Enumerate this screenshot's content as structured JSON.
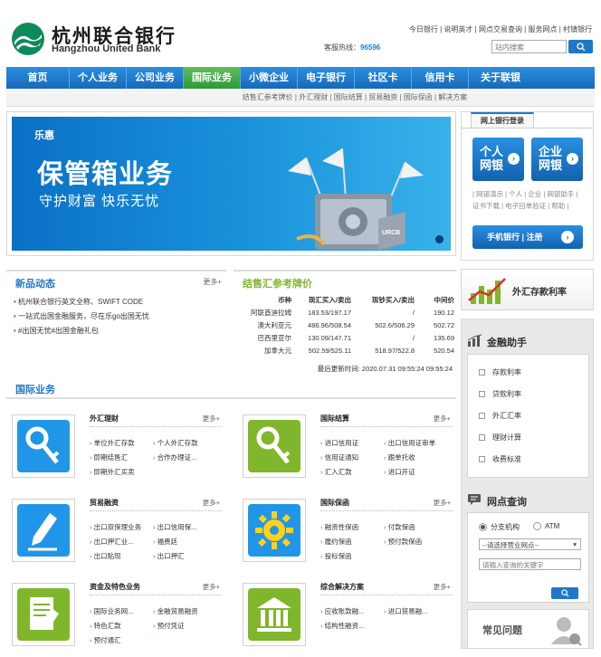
{
  "brand": {
    "name_cn": "杭州联合银行",
    "name_en": "Hangzhou United Bank"
  },
  "top_links": {
    "text": "今日银行 | 说明英才 | 网点交易查询 | 服务网点 | 村镇银行"
  },
  "hotline": {
    "label": "客服热线：",
    "number": "96596"
  },
  "search": {
    "placeholder": "站内搜索"
  },
  "nav": {
    "items": [
      "首页",
      "个人业务",
      "公司业务",
      "国际业务",
      "小微企业",
      "电子银行",
      "社区卡",
      "信用卡",
      "关于联银"
    ],
    "active": "国际业务"
  },
  "subnav": {
    "text": "结售汇参考牌价 | 外汇理财 | 国际结算 | 贸易融资 | 国际保函 | 解决方案"
  },
  "banner": {
    "brand": "乐惠",
    "title": "保管箱业务",
    "subtitle": "守护财富  快乐无忧",
    "badge": "URCB"
  },
  "login": {
    "tab": "网上银行登录",
    "personal": "个人网银",
    "corporate": "企业网银",
    "links": "| 网银演示 | 个人 | 企业 | 网银助手 | 证书下载 | 电子回单验证 | 帮助 |",
    "mobile": "手机银行 | 注册"
  },
  "news": {
    "title": "新品动态",
    "more": "更多+",
    "items": [
      "杭州联合银行英文全称、SWIFT CODE",
      "一站式出国金融服务，尽在乐go出国无忧",
      "#出国无忧#出国金融礼包"
    ]
  },
  "fx": {
    "title": "结售汇参考牌价",
    "headers": [
      "币种",
      "现汇买入/卖出",
      "现钞买入/卖出",
      "中间价"
    ],
    "rows": [
      [
        "阿联酋迪拉姆",
        "183.53/197.17",
        "/",
        "190.12"
      ],
      [
        "澳大利亚元",
        "486.96/508.54",
        "502.6/506.29",
        "502.72"
      ],
      [
        "巴西里亚尔",
        "130.09/147.71",
        "/",
        "135.69"
      ],
      [
        "加拿大元",
        "502.59/525.11",
        "518.97/522.8",
        "520.54"
      ]
    ],
    "updated": "最后更新时间: 2020.07.31 09:55:24 09:55:24"
  },
  "side": {
    "rate_title": "外汇存款利率",
    "fin_title": "金融助手",
    "fin_items": [
      "存款利率",
      "贷款利率",
      "外汇汇率",
      "理财计算",
      "收费标准"
    ],
    "branch_title": "网点查询",
    "branch_opt1": "分支机构",
    "branch_opt2": "ATM",
    "branch_select": "--请选择营业网点--",
    "branch_input": "请输入查询的关键字",
    "faq_title": "常见问题"
  },
  "intl": {
    "title": "国际业务",
    "cards": [
      {
        "title": "外汇理财",
        "more": "更多+",
        "links": [
          "单位外汇存款",
          "个人外汇存款",
          "即期结售汇",
          "合作办理证...",
          "即期外汇买卖"
        ]
      },
      {
        "title": "国际结算",
        "more": "更多+",
        "links": [
          "进口信用证",
          "出口信用证审单",
          "信用证通知",
          "跟单托收",
          "汇入汇款",
          "进口开证"
        ]
      },
      {
        "title": "贸易融资",
        "more": "更多+",
        "links": [
          "出口双保理业务",
          "出口信用保...",
          "出口押汇业...",
          "福费廷",
          "出口贴现",
          "出口押汇"
        ]
      },
      {
        "title": "国际保函",
        "more": "更多+",
        "links": [
          "融资性保函",
          "付款保函",
          "履约保函",
          "预付款保函",
          "投标保函"
        ]
      },
      {
        "title": "资金及特色业务",
        "more": "更多+",
        "links": [
          "国际业务网...",
          "金融贸易融资",
          "特色汇款",
          "预付凭证",
          "预付通汇"
        ]
      },
      {
        "title": "综合解决方案",
        "more": "更多+",
        "links": [
          "应收账款融...",
          "进口贸易融...",
          "结构性融资..."
        ]
      }
    ]
  },
  "colors": {
    "primary": "#1f77c8",
    "nav_active": "#2e9a36",
    "icon_blue": "#2196e8",
    "icon_green": "#7fb62b"
  }
}
